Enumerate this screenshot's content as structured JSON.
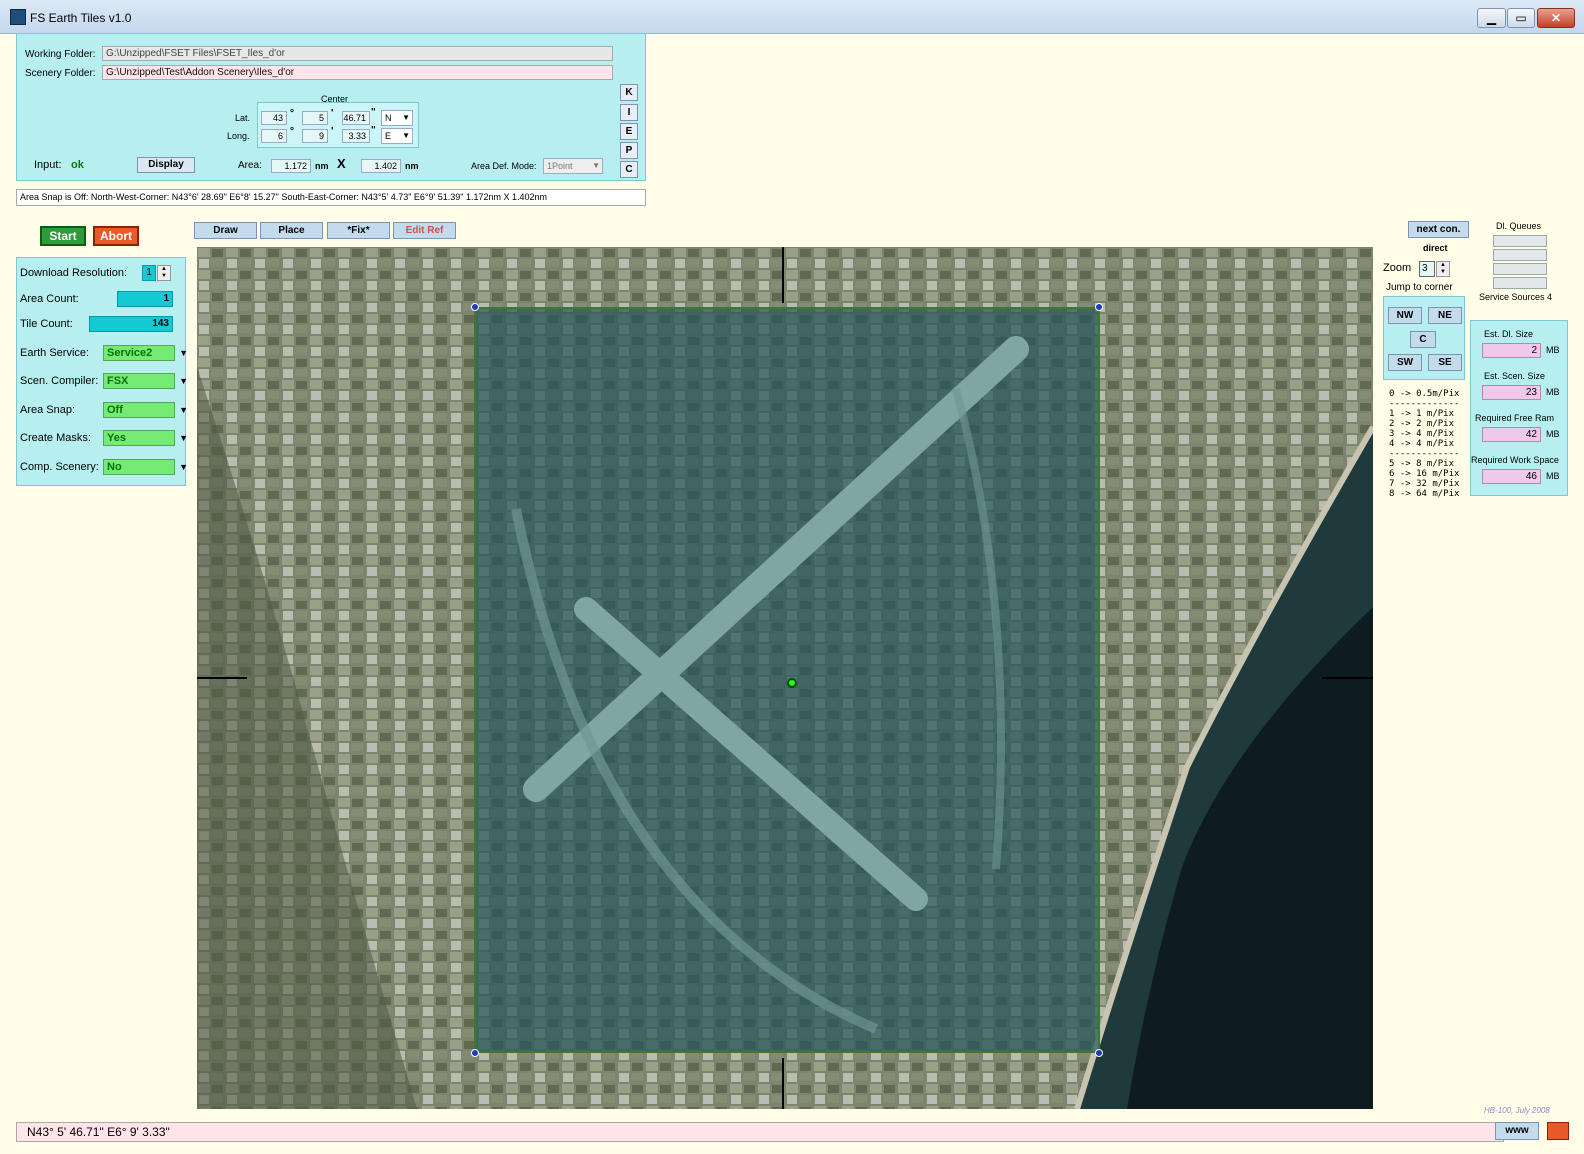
{
  "window": {
    "title": "FS Earth Tiles   v1.0",
    "min": "▁",
    "max": "▭",
    "close": "✕"
  },
  "folders": {
    "working_label": "Working Folder:",
    "working_value": "G:\\Unzipped\\FSET Files\\FSET_Iles_d'or",
    "scenery_label": "Scenery Folder:",
    "scenery_value": "G:\\Unzipped\\Test\\Addon Scenery\\Iles_d'or"
  },
  "center": {
    "label": "Center",
    "lat_label": "Lat.",
    "lat_deg": "43",
    "lat_min": "5",
    "lat_sec": "46.71",
    "lat_hemi": "N",
    "long_label": "Long.",
    "long_deg": "6",
    "long_min": "9",
    "long_sec": "3.33",
    "long_hemi": "E"
  },
  "input": {
    "label": "Input:",
    "status": "ok",
    "display_button": "Display"
  },
  "area": {
    "label": "Area:",
    "width": "1.172",
    "width_unit": "nm",
    "times": "X",
    "height": "1.402",
    "height_unit": "nm"
  },
  "area_def": {
    "label": "Area Def. Mode:",
    "value": "1Point"
  },
  "side_buttons": [
    "K",
    "I",
    "E",
    "P",
    "C"
  ],
  "status_line": "Area Snap is Off:   North-West-Corner: N43°6' 28.69\"    E6°8' 15.27\"    South-East-Corner: N43°5' 4.73\"    E6°9' 51.39\"    1.172nm X 1.402nm",
  "actions": {
    "start": "Start",
    "abort": "Abort"
  },
  "modes": {
    "draw": "Draw",
    "place": "Place",
    "fix": "*Fix*",
    "edit_ref": "Edit Ref"
  },
  "settings": {
    "download_resolution_label": "Download Resolution:",
    "download_resolution": "1",
    "area_count_label": "Area Count:",
    "area_count": "1",
    "tile_count_label": "Tile Count:",
    "tile_count": "143",
    "earth_service_label": "Earth Service:",
    "earth_service": "Service2",
    "scen_compiler_label": "Scen. Compiler:",
    "scen_compiler": "FSX",
    "area_snap_label": "Area Snap:",
    "area_snap": "Off",
    "create_masks_label": "Create Masks:",
    "create_masks": "Yes",
    "comp_scenery_label": "Comp. Scenery:",
    "comp_scenery": "No"
  },
  "nav": {
    "next_con": "next con.",
    "direct": "direct",
    "zoom_label": "Zoom",
    "zoom_value": "3",
    "jump_label": "Jump to corner",
    "nw": "NW",
    "ne": "NE",
    "c": "C",
    "sw": "SW",
    "se": "SE"
  },
  "zoom_table": {
    "r0": "0 -> 0.5m/Pix",
    "sep": "-------------",
    "r1": "1 ->  1 m/Pix",
    "r2": "2 ->  2 m/Pix",
    "r3": "3 ->  4 m/Pix",
    "r4": "4 ->  4 m/Pix",
    "sep2": "-------------",
    "r5": "5 ->  8 m/Pix",
    "r6": "6 -> 16 m/Pix",
    "r7": "7 -> 32 m/Pix",
    "r8": "8 -> 64 m/Pix"
  },
  "queues": {
    "label": "Dl. Queues",
    "sources": "Service Sources 4"
  },
  "sizes": {
    "dl_label": "Est. Dl. Size",
    "dl_value": "2",
    "scen_label": "Est. Scen. Size",
    "scen_value": "23",
    "ram_label": "Required Free Ram",
    "ram_value": "42",
    "work_label": "Required Work Space",
    "work_value": "46",
    "unit": "MB"
  },
  "bottom": {
    "coords": "N43° 5' 46.71\"     E6° 9' 3.33\"",
    "www": "www",
    "credit": "HB-100,  July 2008"
  },
  "colors": {
    "panel": "#b7eff0",
    "background": "#fffde8",
    "selection": "#28585a",
    "start": "#2e9b3a",
    "abort": "#e85a2a"
  }
}
